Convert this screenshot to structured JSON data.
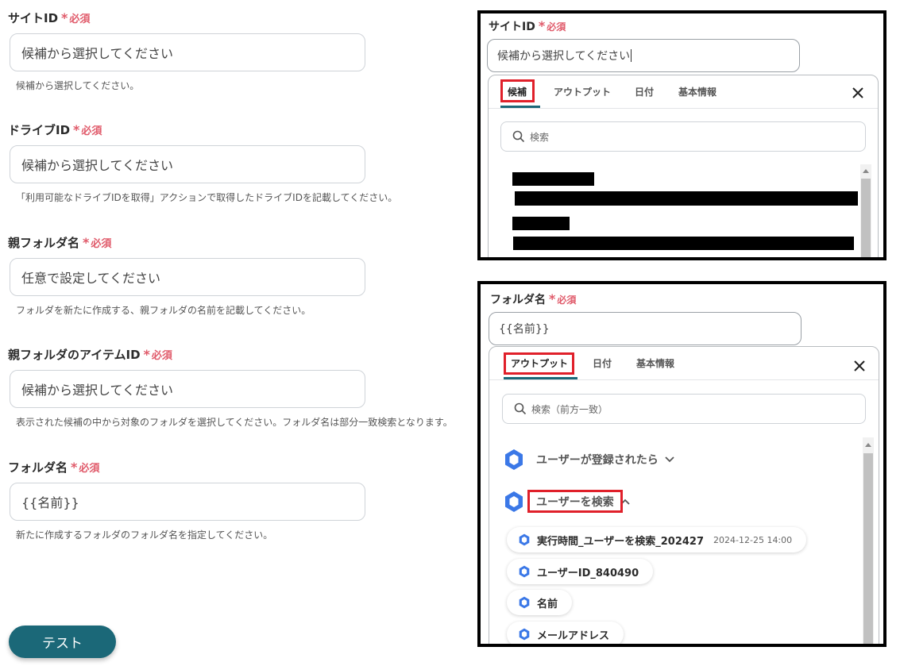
{
  "required_text": "必須",
  "form": {
    "fields": [
      {
        "label": "サイトID",
        "value": "候補から選択してください",
        "help": "候補から選択してください。"
      },
      {
        "label": "ドライブID",
        "value": "候補から選択してください",
        "help": "「利用可能なドライブIDを取得」アクションで取得したドライブIDを記載してください。"
      },
      {
        "label": "親フォルダ名",
        "value": "任意で設定してください",
        "help": "フォルダを新たに作成する、親フォルダの名前を記載してください。"
      },
      {
        "label": "親フォルダのアイテムID",
        "value": "候補から選択してください",
        "help": "表示された候補の中から対象のフォルダを選択してください。フォルダ名は部分一致検索となります。"
      },
      {
        "label": "フォルダ名",
        "value": "{{名前}}",
        "help": "新たに作成するフォルダのフォルダ名を指定してください。"
      }
    ],
    "test_button": "テスト"
  },
  "panel_top": {
    "label": "サイトID",
    "input_value": "候補から選択してください",
    "tabs": [
      "候補",
      "アウトプット",
      "日付",
      "基本情報"
    ],
    "active_tab": 0,
    "search_placeholder": "検索"
  },
  "panel_bottom": {
    "label": "フォルダ名",
    "input_value": "{{名前}}",
    "tabs": [
      "アウトプット",
      "日付",
      "基本情報"
    ],
    "active_tab": 0,
    "search_placeholder": "検索（前方一致）",
    "groups": [
      {
        "label": "ユーザーが登録されたら",
        "expanded": false
      },
      {
        "label": "ユーザーを検索",
        "expanded": true
      }
    ],
    "items": [
      {
        "label": "実行時間_ユーザーを検索_202427",
        "timestamp": "2024-12-25 14:00"
      },
      {
        "label": "ユーザーID_840490"
      },
      {
        "label": "名前"
      },
      {
        "label": "メールアドレス"
      }
    ]
  },
  "colors": {
    "accent": "#1b6878",
    "required": "#e05a6a",
    "highlight": "#e0202a",
    "hex_icon": "#3b78e7"
  }
}
